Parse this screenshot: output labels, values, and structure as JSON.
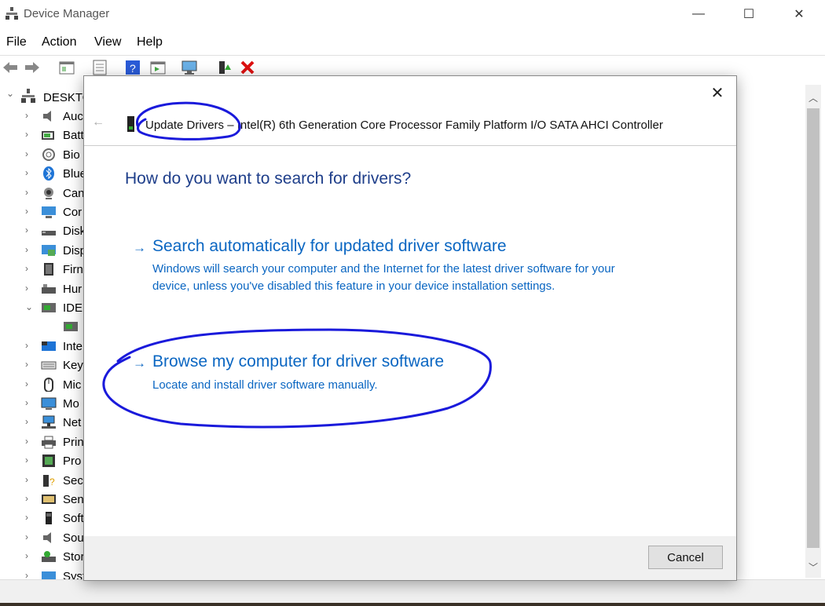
{
  "window": {
    "title": "Device Manager",
    "controls": [
      "—",
      "☐",
      "✕"
    ]
  },
  "menu": [
    "File",
    "Action",
    "View",
    "Help"
  ],
  "toolbar": [
    "back-icon",
    "forward-icon",
    "properties-icon",
    "update-icon",
    "help-icon",
    "show-hidden-icon",
    "scan-icon",
    "enable-icon",
    "remove-icon"
  ],
  "tree": {
    "root": "DESKTO",
    "items": [
      {
        "label": "Auc",
        "chev": "›",
        "icon": "audio-icon"
      },
      {
        "label": "Batt",
        "chev": "›",
        "icon": "battery-icon"
      },
      {
        "label": "Bio",
        "chev": "›",
        "icon": "biometric-icon"
      },
      {
        "label": "Blue",
        "chev": "›",
        "icon": "bluetooth-icon"
      },
      {
        "label": "Can",
        "chev": "›",
        "icon": "camera-icon"
      },
      {
        "label": "Cor",
        "chev": "›",
        "icon": "computer-icon"
      },
      {
        "label": "Disk",
        "chev": "›",
        "icon": "disk-icon"
      },
      {
        "label": "Disp",
        "chev": "›",
        "icon": "display-icon"
      },
      {
        "label": "Firn",
        "chev": "›",
        "icon": "firmware-icon"
      },
      {
        "label": "Hur",
        "chev": "›",
        "icon": "hid-icon"
      },
      {
        "label": "IDE",
        "chev": "⌄",
        "icon": "ide-icon"
      },
      {
        "label": "",
        "chev": "",
        "icon": "controller-icon"
      },
      {
        "label": "Inte",
        "chev": "›",
        "icon": "intel-icon"
      },
      {
        "label": "Key",
        "chev": "›",
        "icon": "keyboard-icon"
      },
      {
        "label": "Mic",
        "chev": "›",
        "icon": "mouse-icon"
      },
      {
        "label": "Mo",
        "chev": "›",
        "icon": "monitor-icon"
      },
      {
        "label": "Net",
        "chev": "›",
        "icon": "network-icon"
      },
      {
        "label": "Prin",
        "chev": "›",
        "icon": "printer-icon"
      },
      {
        "label": "Pro",
        "chev": "›",
        "icon": "processor-icon"
      },
      {
        "label": "Secu",
        "chev": "›",
        "icon": "security-icon"
      },
      {
        "label": "Sen",
        "chev": "›",
        "icon": "sensor-icon"
      },
      {
        "label": "Soft",
        "chev": "›",
        "icon": "software-icon"
      },
      {
        "label": "Sou",
        "chev": "›",
        "icon": "sound-icon"
      },
      {
        "label": "Stor",
        "chev": "›",
        "icon": "storage-icon"
      },
      {
        "label": "Syst",
        "chev": "›",
        "icon": "system-icon"
      }
    ]
  },
  "dialog": {
    "back": "←",
    "close": "✕",
    "header": "Update Drivers – Intel(R) 6th Generation Core Processor Family Platform I/O SATA AHCI Controller",
    "question": "How do you want to search for drivers?",
    "options": [
      {
        "arrow": "→",
        "title": "Search automatically for updated driver software",
        "description": "Windows will search your computer and the Internet for the latest driver software for your device, unless you've disabled this feature in your device installation settings."
      },
      {
        "arrow": "→",
        "title": "Browse my computer for driver software",
        "description": "Locate and install driver software manually."
      }
    ],
    "cancel": "Cancel"
  },
  "annotation_color": "#1a1adb"
}
